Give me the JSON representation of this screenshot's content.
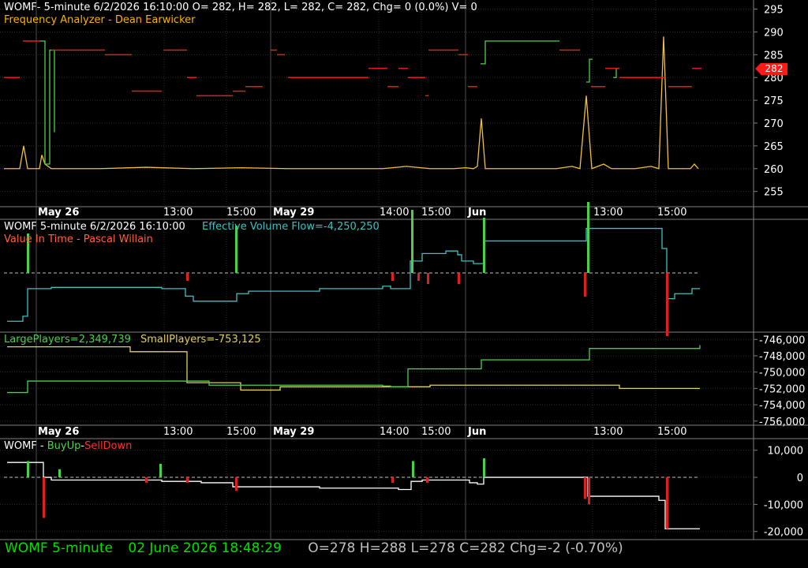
{
  "panels": {
    "price": {
      "title_line1": "WOMF- 5-minute 6/2/2026 16:10:00 O= 282, H= 282, L= 282, C= 282, Chg= 0 (0.0%) V= 0",
      "title_line2": "Frequency Analyzer - Dean Earwicker",
      "axis_ticks": [
        "295",
        "290",
        "285",
        "280",
        "275",
        "270",
        "265",
        "260",
        "255"
      ],
      "last_price": "282"
    },
    "volume_flow": {
      "title_a": "WOMF 5-minute  6/2/2026 16:10:00",
      "title_b": "Effective Volume Flow=-4,250,250",
      "title_line2": "Value In Time - Pascal Willain"
    },
    "players": {
      "large_label": "LargePlayers=2,349,739",
      "small_label": "SmallPlayers=-753,125",
      "axis_ticks": [
        "746,000",
        "748,000",
        "750,000",
        "752,000",
        "754,000",
        "756,000"
      ]
    },
    "buyup": {
      "title_prefix": "WOMF - ",
      "buy_label": "BuyUp",
      "sep": "-",
      "sell_label": "SellDown",
      "axis_ticks": [
        "10,000",
        "0",
        "-10,000",
        "-20,000"
      ]
    }
  },
  "x_axis_labels": [
    {
      "text": "May 26",
      "bold": true
    },
    {
      "text": "13:00",
      "bold": false
    },
    {
      "text": "15:00",
      "bold": false
    },
    {
      "text": "May 29",
      "bold": true
    },
    {
      "text": "14:00",
      "bold": false
    },
    {
      "text": "15:00",
      "bold": false
    },
    {
      "text": "Jun",
      "bold": true
    },
    {
      "text": "13:00",
      "bold": false
    },
    {
      "text": "15:00",
      "bold": false
    }
  ],
  "status_bar": {
    "symbol": "WOMF",
    "interval": "5-minute",
    "datetime": "02 June 2026 18:48:29",
    "open": "O=278",
    "high": "H=288",
    "low": "L=278",
    "close": "C=282",
    "change": "Chg=-2 (-0.70%)"
  },
  "colors": {
    "background": "#000000",
    "grid": "#3a3a3a",
    "title_white": "#ffffff",
    "title_orange": "#ffb000",
    "teal": "#40c0c0",
    "value_red": "#ff6040",
    "green_line": "#4ccf4c",
    "yellow_line": "#e0d060",
    "red_line": "#e02020",
    "status_green": "#00e000",
    "status_grey": "#c0c0c0"
  },
  "chart_data": {
    "type": "line",
    "x_range": [
      0,
      880
    ],
    "series": [
      {
        "panel": "price",
        "color": "#f0c040",
        "style": "line",
        "points": [
          [
            0,
            260
          ],
          [
            20,
            260
          ],
          [
            25,
            265
          ],
          [
            30,
            260
          ],
          [
            45,
            260
          ],
          [
            48,
            263
          ],
          [
            52,
            261
          ],
          [
            60,
            260
          ],
          [
            120,
            260
          ],
          [
            180,
            260.3
          ],
          [
            240,
            260
          ],
          [
            300,
            260.2
          ],
          [
            360,
            260
          ],
          [
            420,
            260
          ],
          [
            480,
            260
          ],
          [
            510,
            260.5
          ],
          [
            540,
            260
          ],
          [
            570,
            260
          ],
          [
            585,
            260.2
          ],
          [
            595,
            260
          ],
          [
            600,
            260.5
          ],
          [
            605,
            271
          ],
          [
            610,
            260
          ],
          [
            640,
            260
          ],
          [
            700,
            260
          ],
          [
            720,
            260.5
          ],
          [
            730,
            260
          ],
          [
            738,
            276
          ],
          [
            745,
            260
          ],
          [
            760,
            261
          ],
          [
            770,
            260
          ],
          [
            800,
            260
          ],
          [
            820,
            260.5
          ],
          [
            830,
            260
          ],
          [
            836,
            289
          ],
          [
            842,
            260
          ],
          [
            870,
            260
          ],
          [
            875,
            261
          ],
          [
            880,
            260
          ]
        ]
      },
      {
        "panel": "price",
        "color": "#4ccf4c",
        "style": "step",
        "points": [
          [
            46,
            288
          ],
          [
            52,
            261
          ],
          [
            58,
            286
          ],
          [
            64,
            268
          ]
        ]
      },
      {
        "panel": "price",
        "color": "#4ccf4c",
        "style": "step",
        "points": [
          [
            604,
            283
          ],
          [
            610,
            288
          ],
          [
            704,
            288
          ]
        ]
      },
      {
        "panel": "price",
        "color": "#4ccf4c",
        "style": "step",
        "points": [
          [
            738,
            279
          ],
          [
            742,
            284
          ],
          [
            746,
            284
          ]
        ]
      },
      {
        "panel": "price",
        "color": "#4ccf4c",
        "style": "step",
        "points": [
          [
            772,
            280
          ],
          [
            776,
            282
          ],
          [
            780,
            282
          ]
        ]
      },
      {
        "panel": "price",
        "color": "#e02020",
        "style": "hsegs",
        "segments": [
          [
            0,
            20,
            280
          ],
          [
            24,
            46,
            288
          ],
          [
            60,
            128,
            286
          ],
          [
            128,
            162,
            285
          ],
          [
            162,
            200,
            277
          ],
          [
            202,
            232,
            286
          ],
          [
            232,
            244,
            280
          ],
          [
            244,
            290,
            276
          ],
          [
            290,
            306,
            277
          ],
          [
            306,
            328,
            278
          ],
          [
            338,
            346,
            286
          ],
          [
            346,
            356,
            285
          ],
          [
            360,
            462,
            280
          ],
          [
            462,
            486,
            282
          ],
          [
            486,
            500,
            278
          ],
          [
            500,
            512,
            282
          ],
          [
            512,
            534,
            280
          ],
          [
            534,
            538,
            276
          ],
          [
            538,
            576,
            286
          ],
          [
            576,
            588,
            285
          ],
          [
            588,
            600,
            278
          ],
          [
            704,
            730,
            286
          ],
          [
            744,
            762,
            278
          ],
          [
            762,
            780,
            282
          ],
          [
            780,
            838,
            280
          ],
          [
            842,
            872,
            278
          ],
          [
            872,
            884,
            282
          ]
        ]
      },
      {
        "panel": "volume_flow",
        "color": "#40c0c0",
        "style": "step",
        "points": [
          [
            4,
            -380
          ],
          [
            24,
            -360
          ],
          [
            30,
            -250
          ],
          [
            60,
            -245
          ],
          [
            150,
            -245
          ],
          [
            200,
            -250
          ],
          [
            230,
            -280
          ],
          [
            240,
            -300
          ],
          [
            280,
            -300
          ],
          [
            295,
            -270
          ],
          [
            310,
            -260
          ],
          [
            400,
            -250
          ],
          [
            480,
            -240
          ],
          [
            490,
            -250
          ],
          [
            515,
            -140
          ],
          [
            530,
            -110
          ],
          [
            560,
            -100
          ],
          [
            575,
            -115
          ],
          [
            580,
            -140
          ],
          [
            595,
            -150
          ],
          [
            600,
            -150
          ],
          [
            608,
            -60
          ],
          [
            730,
            -60
          ],
          [
            738,
            -10
          ],
          [
            830,
            -10
          ],
          [
            834,
            -90
          ],
          [
            840,
            -290
          ],
          [
            850,
            -270
          ],
          [
            872,
            -250
          ],
          [
            882,
            -250
          ]
        ]
      },
      {
        "panel": "players",
        "color": "#e0d060",
        "style": "step",
        "points": [
          [
            4,
            746900
          ],
          [
            120,
            746900
          ],
          [
            160,
            747500
          ],
          [
            230,
            747500
          ],
          [
            232,
            751300
          ],
          [
            296,
            751300
          ],
          [
            300,
            752200
          ],
          [
            350,
            751800
          ],
          [
            530,
            751800
          ],
          [
            540,
            751600
          ],
          [
            700,
            751600
          ],
          [
            780,
            752000
          ],
          [
            882,
            752000
          ]
        ]
      },
      {
        "panel": "players",
        "color": "#4ccf4c",
        "style": "step",
        "points": [
          [
            4,
            752500
          ],
          [
            28,
            752500
          ],
          [
            30,
            751100
          ],
          [
            200,
            751100
          ],
          [
            260,
            751600
          ],
          [
            480,
            751700
          ],
          [
            490,
            751800
          ],
          [
            512,
            749600
          ],
          [
            600,
            749600
          ],
          [
            605,
            748500
          ],
          [
            735,
            748500
          ],
          [
            742,
            747100
          ],
          [
            882,
            746700
          ]
        ]
      },
      {
        "panel": "buyup",
        "color": "#ffffff",
        "style": "step",
        "points": [
          [
            4,
            5500
          ],
          [
            30,
            5500
          ],
          [
            45,
            5500
          ],
          [
            50,
            0
          ],
          [
            60,
            -1000
          ],
          [
            200,
            -1500
          ],
          [
            250,
            -2000
          ],
          [
            290,
            -3500
          ],
          [
            400,
            -4000
          ],
          [
            500,
            -4500
          ],
          [
            516,
            -1500
          ],
          [
            530,
            -1000
          ],
          [
            590,
            -2000
          ],
          [
            600,
            -2500
          ],
          [
            608,
            0
          ],
          [
            735,
            0
          ],
          [
            740,
            -7000
          ],
          [
            830,
            -8500
          ],
          [
            838,
            -19000
          ],
          [
            882,
            -19000
          ]
        ]
      }
    ]
  }
}
